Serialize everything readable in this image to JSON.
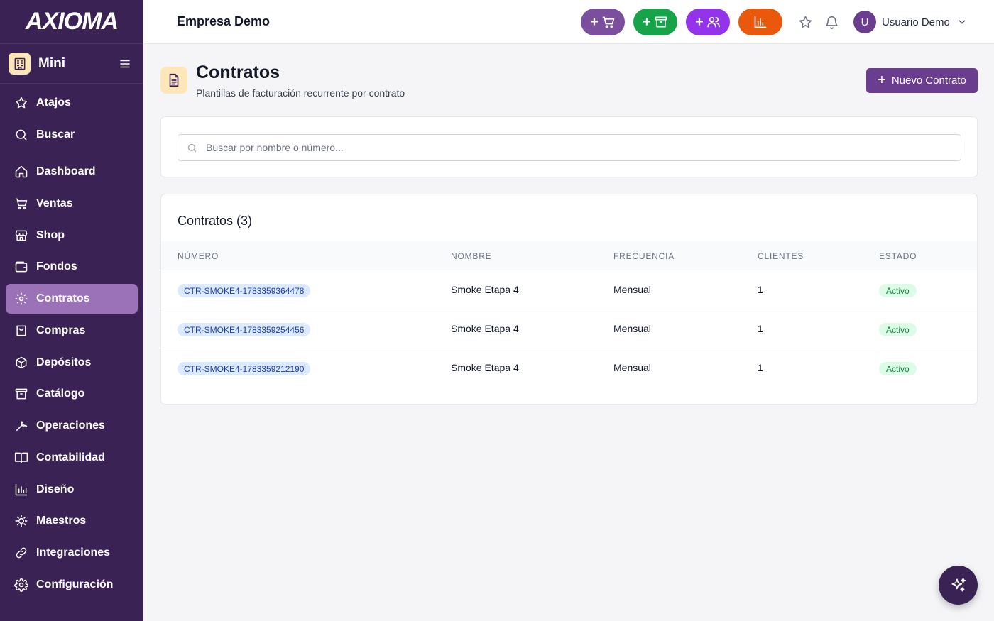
{
  "app": {
    "logo_text": "AXIOMA",
    "company": "Empresa Demo"
  },
  "sidebar": {
    "mode_label": "Mini",
    "items": [
      {
        "label": "Atajos",
        "icon": "star-icon"
      },
      {
        "label": "Buscar",
        "icon": "search-icon"
      },
      {
        "label": "Dashboard",
        "icon": "home-icon"
      },
      {
        "label": "Ventas",
        "icon": "cart-icon"
      },
      {
        "label": "Shop",
        "icon": "store-icon"
      },
      {
        "label": "Fondos",
        "icon": "wallet-icon"
      },
      {
        "label": "Contratos",
        "icon": "gear-icon",
        "active": true
      },
      {
        "label": "Compras",
        "icon": "shopping-bag-icon"
      },
      {
        "label": "Depósitos",
        "icon": "package-icon"
      },
      {
        "label": "Catálogo",
        "icon": "archive-icon"
      },
      {
        "label": "Operaciones",
        "icon": "wrench-icon"
      },
      {
        "label": "Contabilidad",
        "icon": "book-icon"
      },
      {
        "label": "Diseño",
        "icon": "bar-chart-icon"
      },
      {
        "label": "Maestros",
        "icon": "cog-icon"
      },
      {
        "label": "Integraciones",
        "icon": "link-icon"
      },
      {
        "label": "Configuración",
        "icon": "settings-icon"
      }
    ]
  },
  "topbar": {
    "quick_actions": [
      {
        "name": "new-sale",
        "symbol": "+",
        "icon": "cart-icon",
        "color": "#7b4f9e"
      },
      {
        "name": "new-product",
        "symbol": "+",
        "icon": "archive-icon",
        "color": "#16a34a"
      },
      {
        "name": "new-client",
        "symbol": "+",
        "icon": "users-icon",
        "color": "#9333ea"
      },
      {
        "name": "reports",
        "symbol": "",
        "icon": "bar-chart-icon",
        "color": "#ea580c"
      }
    ],
    "user": {
      "initial": "U",
      "name": "Usuario Demo"
    }
  },
  "page": {
    "title": "Contratos",
    "subtitle": "Plantillas de facturación recurrente por contrato",
    "new_button": "Nuevo Contrato",
    "new_button_symbol": "+"
  },
  "search": {
    "placeholder": "Buscar por nombre o número..."
  },
  "table": {
    "title": "Contratos (3)",
    "columns": [
      "NÚMERO",
      "NOMBRE",
      "FRECUENCIA",
      "CLIENTES",
      "ESTADO"
    ],
    "rows": [
      {
        "numero": "CTR-SMOKE4-1783359364478",
        "nombre": "Smoke Etapa 4",
        "frecuencia": "Mensual",
        "clientes": "1",
        "estado": "Activo"
      },
      {
        "numero": "CTR-SMOKE4-1783359254456",
        "nombre": "Smoke Etapa 4",
        "frecuencia": "Mensual",
        "clientes": "1",
        "estado": "Activo"
      },
      {
        "numero": "CTR-SMOKE4-1783359212190",
        "nombre": "Smoke Etapa 4",
        "frecuencia": "Mensual",
        "clientes": "1",
        "estado": "Activo"
      }
    ]
  },
  "colors": {
    "sidebar": "#3b2255",
    "accent": "#6b3d8f",
    "active_item": "#9b72b8"
  }
}
